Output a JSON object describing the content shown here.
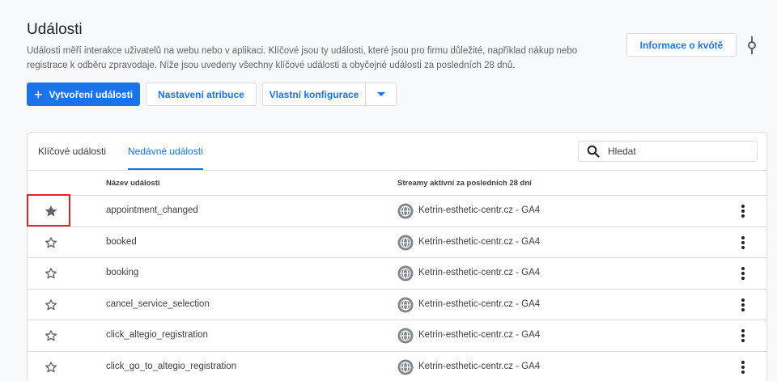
{
  "header": {
    "title": "Události",
    "description": "Události měří interakce uživatelů na webu nebo v aplikaci. Klíčové jsou ty události, které jsou pro firmu důležité, například nákup nebo registrace k odběru zpravodaje. Níže jsou uvedeny všechny klíčové události a obyčejné události za posledních 28 dnů.",
    "quota_button": "Informace o kvótě"
  },
  "toolbar": {
    "create_label": "Vytvoření události",
    "attribution_label": "Nastavení atribuce",
    "custom_config_label": "Vlastní konfigurace"
  },
  "tabs": {
    "key_events": "Klíčové události",
    "recent_events": "Nedávné události"
  },
  "search": {
    "placeholder": "Hledat"
  },
  "table": {
    "col_name": "Název události",
    "col_streams": "Streamy aktivní za posledních 28 dní",
    "rows": [
      {
        "name": "appointment_changed",
        "stream": "Ketrin-esthetic-centr.cz - GA4",
        "starred": true
      },
      {
        "name": "booked",
        "stream": "Ketrin-esthetic-centr.cz - GA4",
        "starred": false
      },
      {
        "name": "booking",
        "stream": "Ketrin-esthetic-centr.cz - GA4",
        "starred": false
      },
      {
        "name": "cancel_service_selection",
        "stream": "Ketrin-esthetic-centr.cz - GA4",
        "starred": false
      },
      {
        "name": "click_altegio_registration",
        "stream": "Ketrin-esthetic-centr.cz - GA4",
        "starred": false
      },
      {
        "name": "click_go_to_altegio_registration",
        "stream": "Ketrin-esthetic-centr.cz - GA4",
        "starred": false
      }
    ]
  },
  "colors": {
    "accent": "#1a73e8",
    "highlight": "#e8221c",
    "border": "#dadce0"
  },
  "icons": {
    "star": "star-icon",
    "globe": "globe-icon",
    "more": "more-vert-icon",
    "search": "search-icon",
    "plus": "plus-icon",
    "dropdown": "caret-down-icon",
    "side": "graph-node-icon"
  }
}
